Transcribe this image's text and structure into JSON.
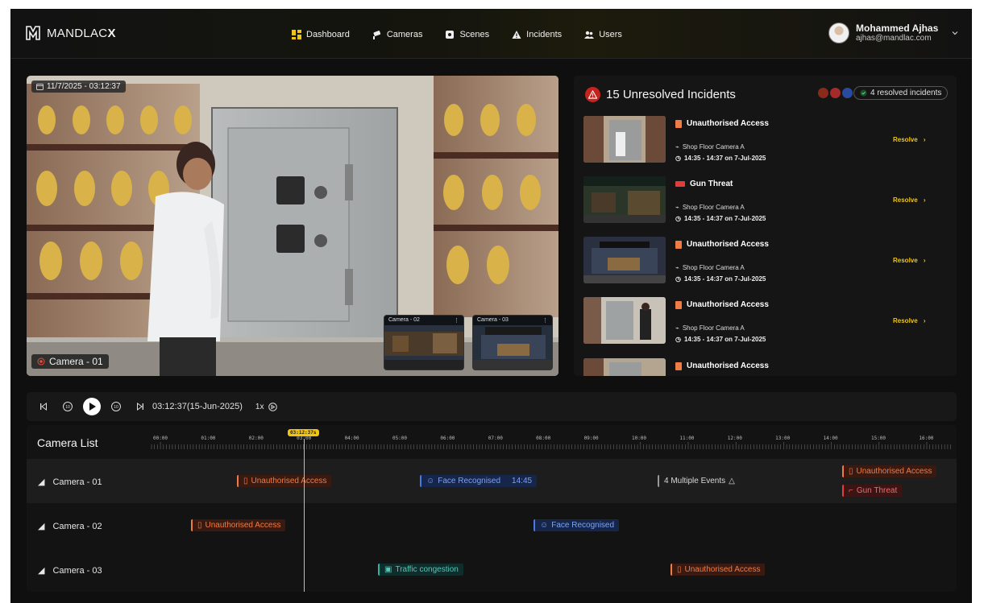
{
  "brand": {
    "name_light": "MANDLAC",
    "name_bold": "X"
  },
  "nav": [
    {
      "label": "Dashboard",
      "icon": "grid-icon"
    },
    {
      "label": "Cameras",
      "icon": "camera-icon"
    },
    {
      "label": "Scenes",
      "icon": "scene-icon"
    },
    {
      "label": "Incidents",
      "icon": "warning-icon"
    },
    {
      "label": "Users",
      "icon": "users-icon"
    }
  ],
  "user": {
    "name": "Mohammed Ajhas",
    "email": "ajhas@mandlac.com"
  },
  "video": {
    "timestamp": "11/7/2025 - 03:12:37",
    "camera_label": "Camera - 01",
    "thumbnails": [
      {
        "label": "Camera - 02"
      },
      {
        "label": "Camera - 03"
      }
    ]
  },
  "incidents": {
    "title": "15 Unresolved Incidents",
    "resolved_label": "4 resolved incidents",
    "items": [
      {
        "name": "Unauthorised Access",
        "type": "ua",
        "camera": "Shop Floor Camera A",
        "time": "14:35 - 14:37 on 7-Jul-2025",
        "action": "Resolve"
      },
      {
        "name": "Gun Threat",
        "type": "gt",
        "camera": "Shop Floor Camera A",
        "time": "14:35 - 14:37 on 7-Jul-2025",
        "action": "Resolve"
      },
      {
        "name": "Unauthorised Access",
        "type": "ua",
        "camera": "Shop Floor Camera A",
        "time": "14:35 - 14:37 on 7-Jul-2025",
        "action": "Resolve"
      },
      {
        "name": "Unauthorised Access",
        "type": "ua",
        "camera": "Shop Floor Camera A",
        "time": "14:35 - 14:37 on 7-Jul-2025",
        "action": "Resolve"
      },
      {
        "name": "Unauthorised Access",
        "type": "ua"
      }
    ]
  },
  "player": {
    "time": "03:12:37(15-Jun-2025)",
    "speed": "1x"
  },
  "timeline": {
    "title": "Camera List",
    "playhead": "03:12:37s",
    "hours": [
      "00:00",
      "01:00",
      "02:00",
      "03:00",
      "04:00",
      "05:00",
      "06:00",
      "07:00",
      "08:00",
      "09:00",
      "10:00",
      "11:00",
      "12:00",
      "13:00",
      "14:00",
      "15:00",
      "16:00"
    ],
    "cameras": [
      {
        "name": "Camera - 01",
        "events": [
          {
            "label": "Unauthorised Access",
            "type": "ua"
          },
          {
            "label": "Face Recognised",
            "type": "fr",
            "time": "14:45"
          },
          {
            "label": "4 Multiple Events",
            "type": "me"
          },
          {
            "label": "Unauthorised Access",
            "type": "ua"
          },
          {
            "label": "Gun Threat",
            "type": "gt"
          }
        ]
      },
      {
        "name": "Camera - 02",
        "events": [
          {
            "label": "Unauthorised Access",
            "type": "ua"
          },
          {
            "label": "Face Recognised",
            "type": "fr"
          }
        ]
      },
      {
        "name": "Camera - 03",
        "events": [
          {
            "label": "Traffic congestion",
            "type": "tc"
          },
          {
            "label": "Unauthorised Access",
            "type": "ua"
          }
        ]
      }
    ]
  },
  "colors": {
    "accent": "#f1c40f",
    "danger": "#c4241c",
    "orange": "#ef7c45",
    "blue": "#4d78e0",
    "teal": "#2fb3a2"
  }
}
